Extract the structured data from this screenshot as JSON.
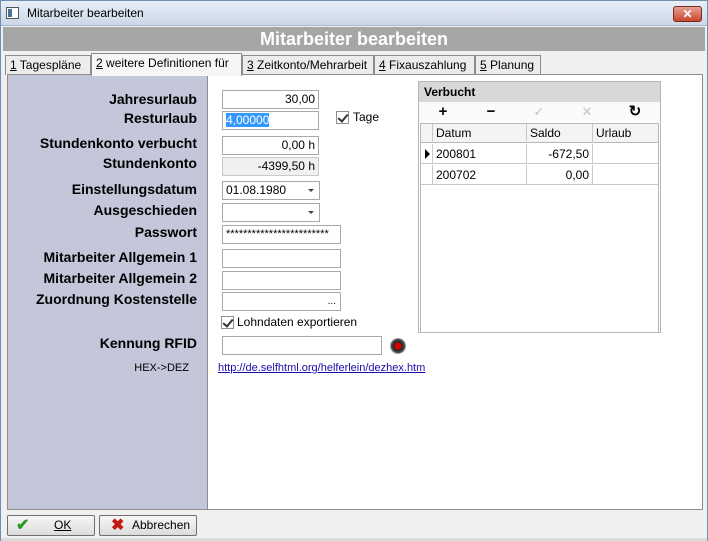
{
  "window": {
    "title": "Mitarbeiter bearbeiten",
    "close_label": "✕"
  },
  "header": {
    "title": "Mitarbeiter bearbeiten"
  },
  "tabs": [
    {
      "key": "1",
      "label": " Tagespläne"
    },
    {
      "key": "2",
      "label": " weitere Definitionen für"
    },
    {
      "key": "3",
      "label": " Zeitkonto/Mehrarbeit"
    },
    {
      "key": "4",
      "label": " Fixauszahlung"
    },
    {
      "key": "5",
      "label": " Planung"
    }
  ],
  "form": {
    "jahresurlaub": {
      "label": "Jahresurlaub",
      "value": "30,00"
    },
    "resturlaub": {
      "label": "Resturlaub",
      "value": "4,00000"
    },
    "tage": {
      "label": "Tage",
      "checked": true
    },
    "stundenkonto_verbucht": {
      "label": "Stundenkonto verbucht",
      "value": "0,00 h"
    },
    "stundenkonto": {
      "label": "Stundenkonto",
      "value": "-4399,50 h"
    },
    "einstellungsdatum": {
      "label": "Einstellungsdatum",
      "value": "01.08.1980"
    },
    "ausgeschieden": {
      "label": "Ausgeschieden",
      "value": ""
    },
    "passwort": {
      "label": "Passwort",
      "value": "************************"
    },
    "allgemein1": {
      "label": "Mitarbeiter Allgemein 1",
      "value": ""
    },
    "allgemein2": {
      "label": "Mitarbeiter Allgemein 2",
      "value": ""
    },
    "kostenstelle": {
      "label": "Zuordnung Kostenstelle",
      "value": "",
      "button": "..."
    },
    "lohndaten": {
      "label": "Lohndaten exportieren",
      "checked": true
    },
    "rfid": {
      "label": "Kennung RFID",
      "value": ""
    },
    "hexdez": {
      "label": "HEX->DEZ",
      "link": "http://de.selfhtml.org/helferlein/dezhex.htm"
    }
  },
  "verbucht": {
    "title": "Verbucht",
    "toolbar": {
      "add": "+",
      "remove": "−",
      "confirm": "✓",
      "cancel": "✕",
      "refresh": "↻"
    },
    "columns": [
      "Datum",
      "Saldo",
      "Urlaub"
    ],
    "rows": [
      {
        "datum": "200801",
        "saldo": "-672,50",
        "urlaub": ""
      },
      {
        "datum": "200702",
        "saldo": "0,00",
        "urlaub": ""
      }
    ]
  },
  "buttons": {
    "ok": {
      "label": "OK",
      "icon": "✔"
    },
    "cancel": {
      "label": "Abbrechen",
      "icon": "✖"
    }
  }
}
